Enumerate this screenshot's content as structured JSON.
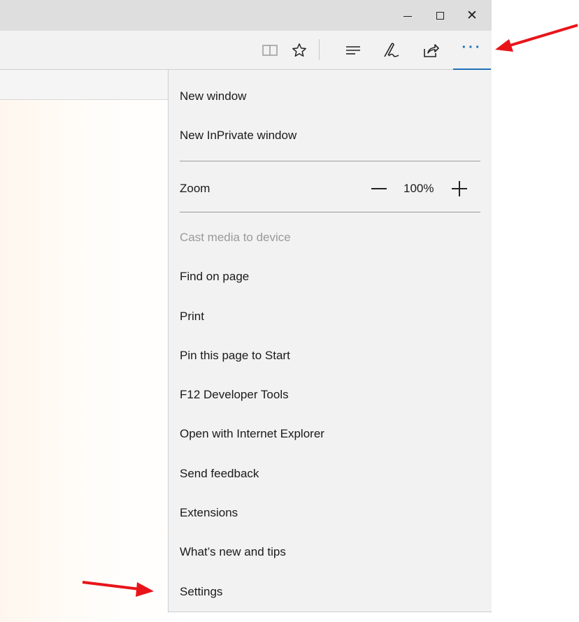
{
  "window_controls": {
    "minimize_icon": "minimize-icon",
    "maximize_icon": "maximize-icon",
    "close_icon": "close-icon"
  },
  "toolbar": {
    "icons": [
      "reading-view-icon",
      "favorite-star-icon",
      "hub-icon",
      "web-note-icon",
      "share-icon",
      "more-actions-icon"
    ],
    "accent_color": "#1f6fb8"
  },
  "menu": {
    "new_window": "New window",
    "new_inprivate_window": "New InPrivate window",
    "zoom_label": "Zoom",
    "zoom_value": "100%",
    "cast_media": "Cast media to device",
    "find_on_page": "Find on page",
    "print": "Print",
    "pin_to_start": "Pin this page to Start",
    "developer_tools": "F12 Developer Tools",
    "open_with_ie": "Open with Internet Explorer",
    "send_feedback": "Send feedback",
    "extensions": "Extensions",
    "whats_new": "What’s new and tips",
    "settings": "Settings"
  },
  "annotations": {
    "arrow_color": "#e8141a"
  }
}
